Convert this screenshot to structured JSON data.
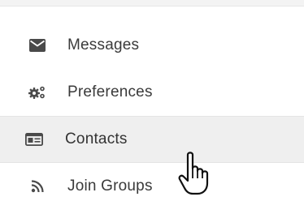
{
  "menu": {
    "items": [
      {
        "label": "Messages",
        "icon": "envelope-icon"
      },
      {
        "label": "Preferences",
        "icon": "gears-icon"
      },
      {
        "label": "Contacts",
        "icon": "contact-card-icon",
        "active": true
      },
      {
        "label": "Join Groups",
        "icon": "rss-feed-icon"
      }
    ]
  },
  "colors": {
    "text": "#3a3a3a",
    "icon": "#4a4a4a",
    "active_background": "#efefef"
  },
  "cursor": {
    "icon": "hand-pointer-cursor-icon"
  }
}
